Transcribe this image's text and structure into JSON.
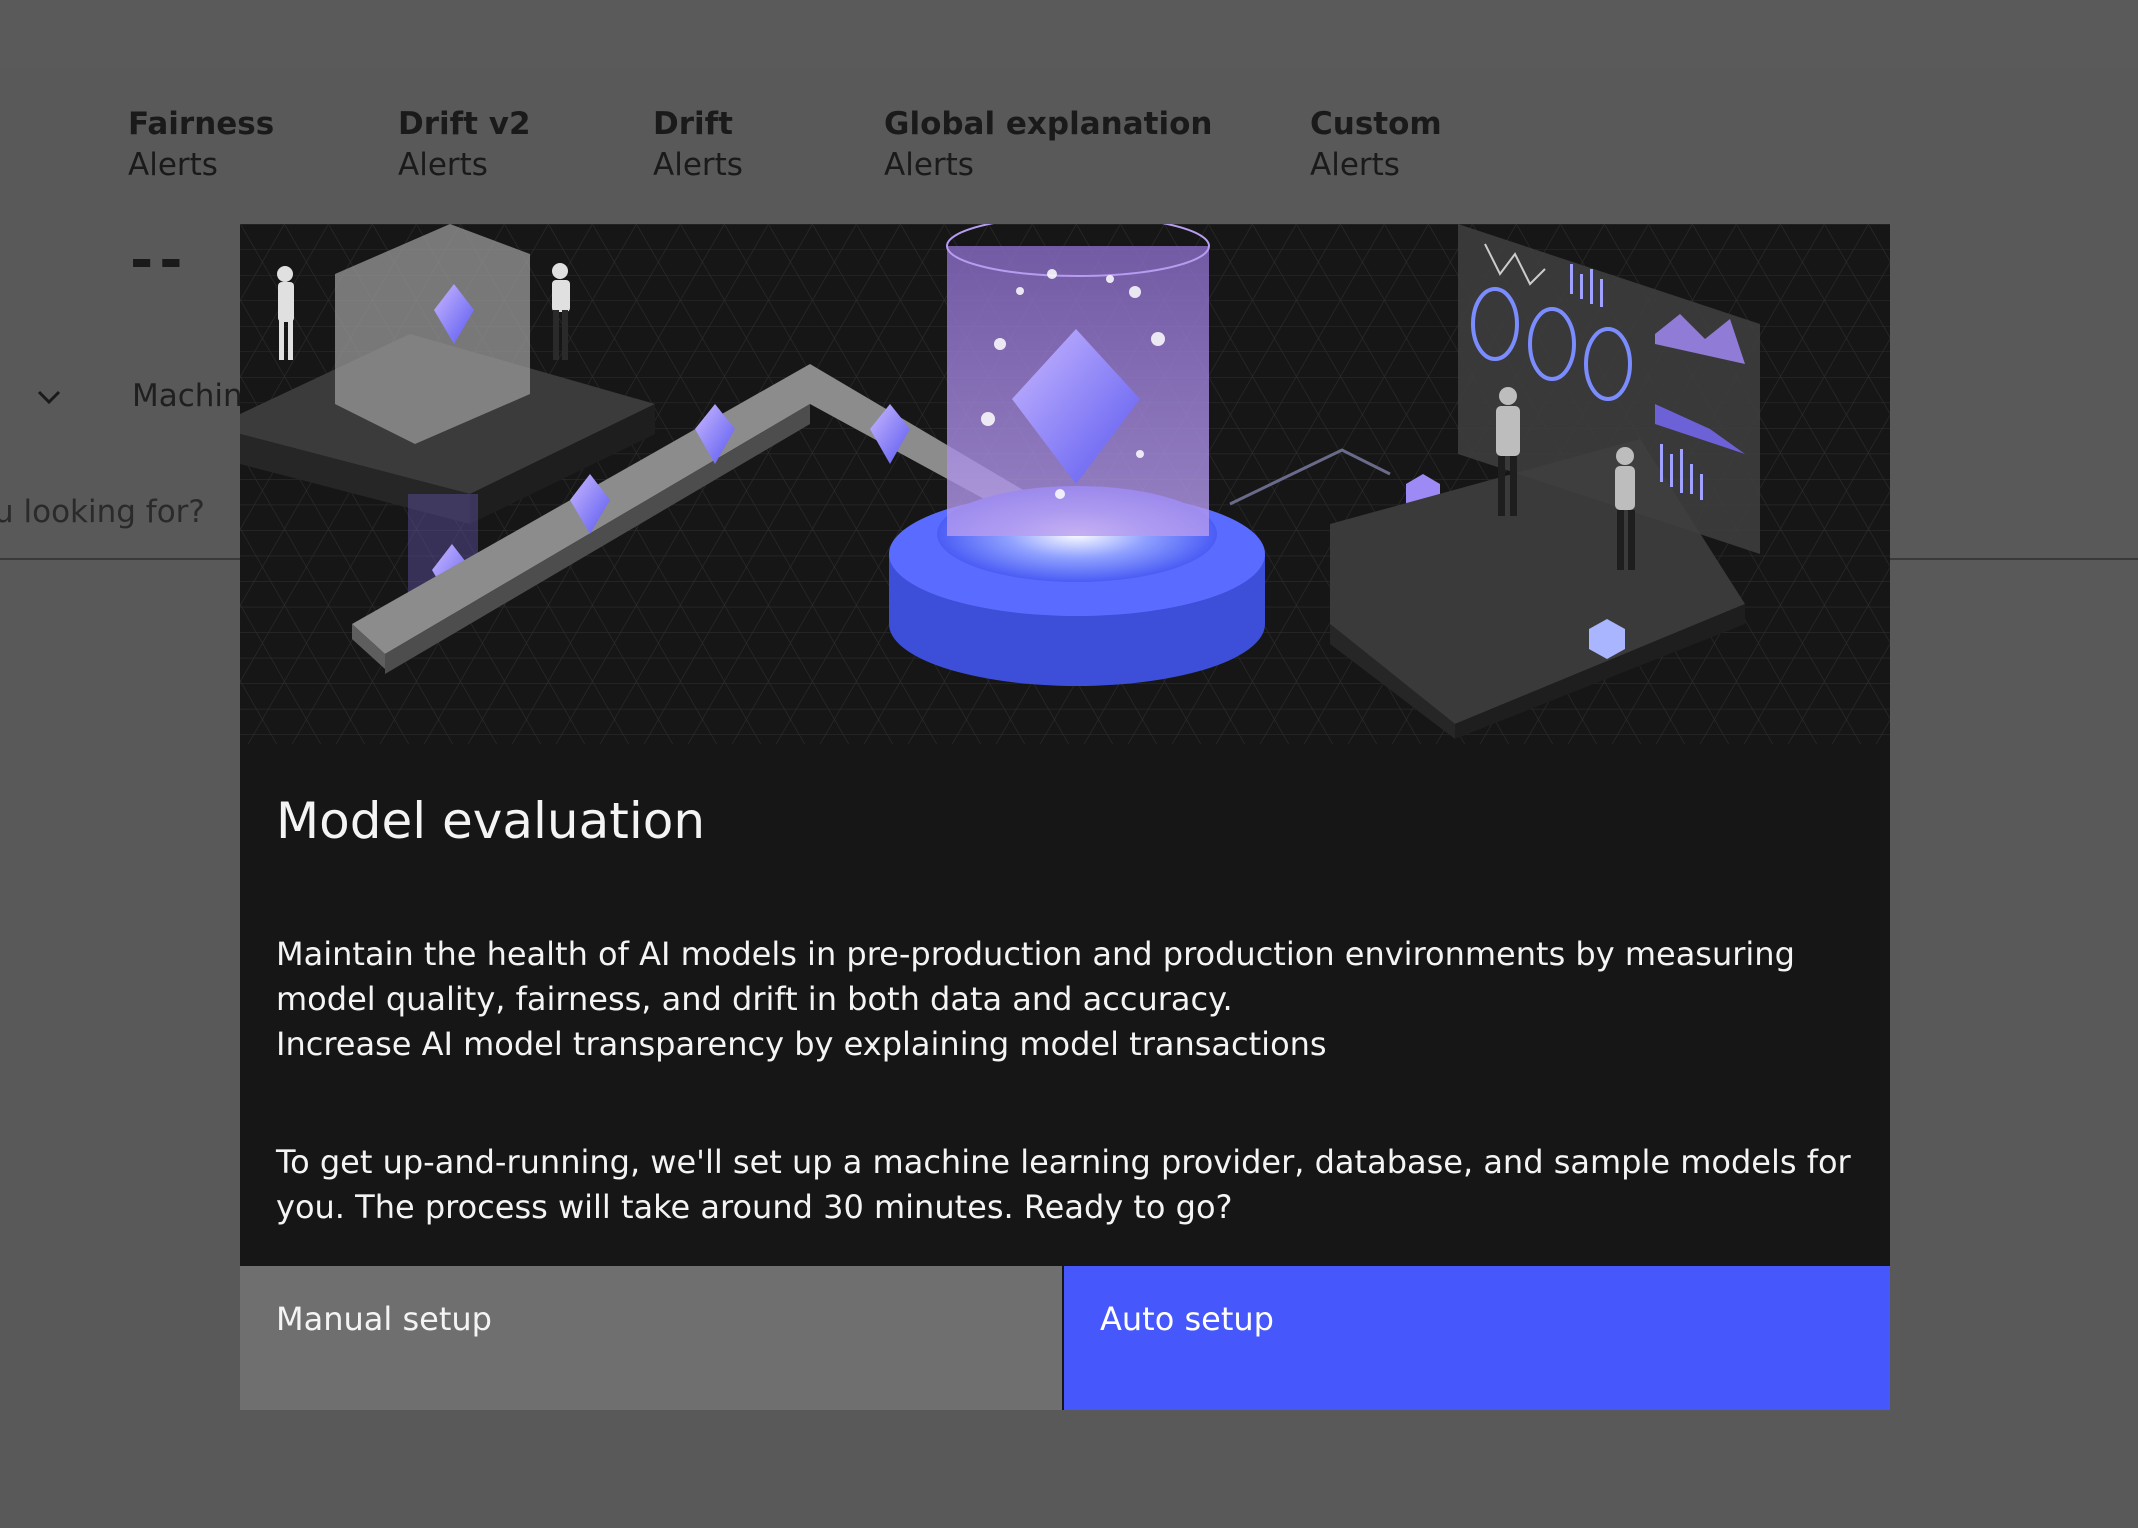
{
  "background": {
    "alert_tabs": [
      {
        "title": "Fairness",
        "subtitle": "Alerts"
      },
      {
        "title": "Drift v2",
        "subtitle": "Alerts"
      },
      {
        "title": "Drift",
        "subtitle": "Alerts"
      },
      {
        "title": "Global explanation",
        "subtitle": "Alerts"
      },
      {
        "title": "Custom",
        "subtitle": "Alerts"
      }
    ],
    "value_placeholder": "--",
    "dropdown_label": "Machine",
    "search_placeholder": "u looking for?"
  },
  "modal": {
    "title": "Model evaluation",
    "paragraph_1_line_1": "Maintain the health of AI models in pre-production and production environments by measuring model quality, fairness, and drift in both data and accuracy.",
    "paragraph_1_line_2": "Increase AI model transparency by explaining model transactions",
    "paragraph_2": "To get up-and-running, we'll set up a machine learning provider, database, and sample models for you. The process will take around 30 minutes. Ready to go?",
    "manual_button": "Manual setup",
    "auto_button": "Auto setup"
  },
  "colors": {
    "overlay": "#5c5c5c",
    "modal_bg": "#161616",
    "primary": "#4658fc",
    "secondary": "#6f6f6f"
  }
}
